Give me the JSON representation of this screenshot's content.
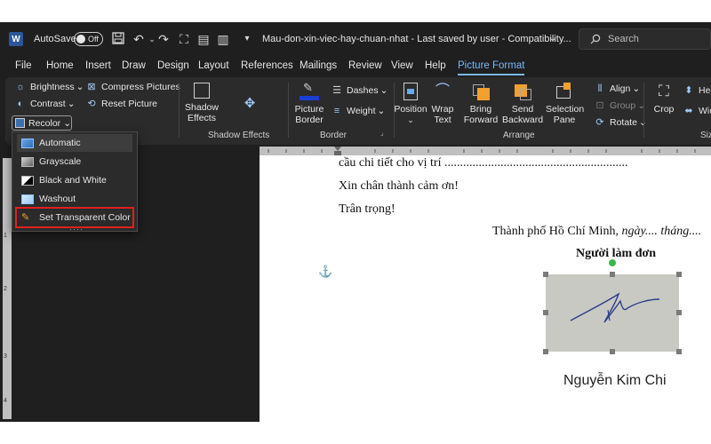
{
  "title_bar": {
    "autosave_label": "AutoSave",
    "autosave_state": "Off",
    "document_title": "Mau-don-xin-viec-hay-chuan-nhat  -  Last saved by user  -  Compatibility...",
    "search_placeholder": "Search"
  },
  "tabs": [
    "File",
    "Home",
    "Insert",
    "Draw",
    "Design",
    "Layout",
    "References",
    "Mailings",
    "Review",
    "View",
    "Help",
    "Picture Format"
  ],
  "active_tab": "Picture Format",
  "ribbon": {
    "adjust": {
      "brightness": "Brightness",
      "contrast": "Contrast",
      "recolor": "Recolor",
      "compress": "Compress Pictures",
      "reset": "Reset Picture"
    },
    "shadow": {
      "shadow_effects": "Shadow Effects",
      "group_label": "Shadow Effects"
    },
    "border": {
      "picture_border": "Picture Border",
      "dashes": "Dashes",
      "weight": "Weight",
      "group_label": "Border"
    },
    "arrange": {
      "position": "Position",
      "wrap_text": "Wrap Text",
      "bring_forward": "Bring Forward",
      "send_backward": "Send Backward",
      "selection_pane": "Selection Pane",
      "align": "Align",
      "group": "Group",
      "rotate": "Rotate",
      "group_label": "Arrange"
    },
    "size": {
      "crop": "Crop",
      "height": "Hei",
      "width": "Wic",
      "group_label": "Siz"
    }
  },
  "recolor_menu": {
    "items": [
      "Automatic",
      "Grayscale",
      "Black and White",
      "Washout",
      "Set Transparent Color"
    ],
    "selected": "Automatic",
    "highlighted": "Set Transparent Color"
  },
  "document": {
    "lines": [
      "cầu chi tiết cho vị trí ...........................................................",
      "Xin chân thành cảm ơn!",
      "Trân trọng!"
    ],
    "place_date_city": "Thành phố Hồ Chí Minh,",
    "place_date_rest": " ngày.... tháng....",
    "signer_label": "Người làm đơn",
    "signer_name": "Nguyễn Kim Chi"
  },
  "colors": {
    "accent": "#79b8f7",
    "highlight_box": "#e02020",
    "title_bar": "#1f1f1f",
    "ribbon": "#2b2b2b",
    "word_blue": "#2b579a"
  }
}
